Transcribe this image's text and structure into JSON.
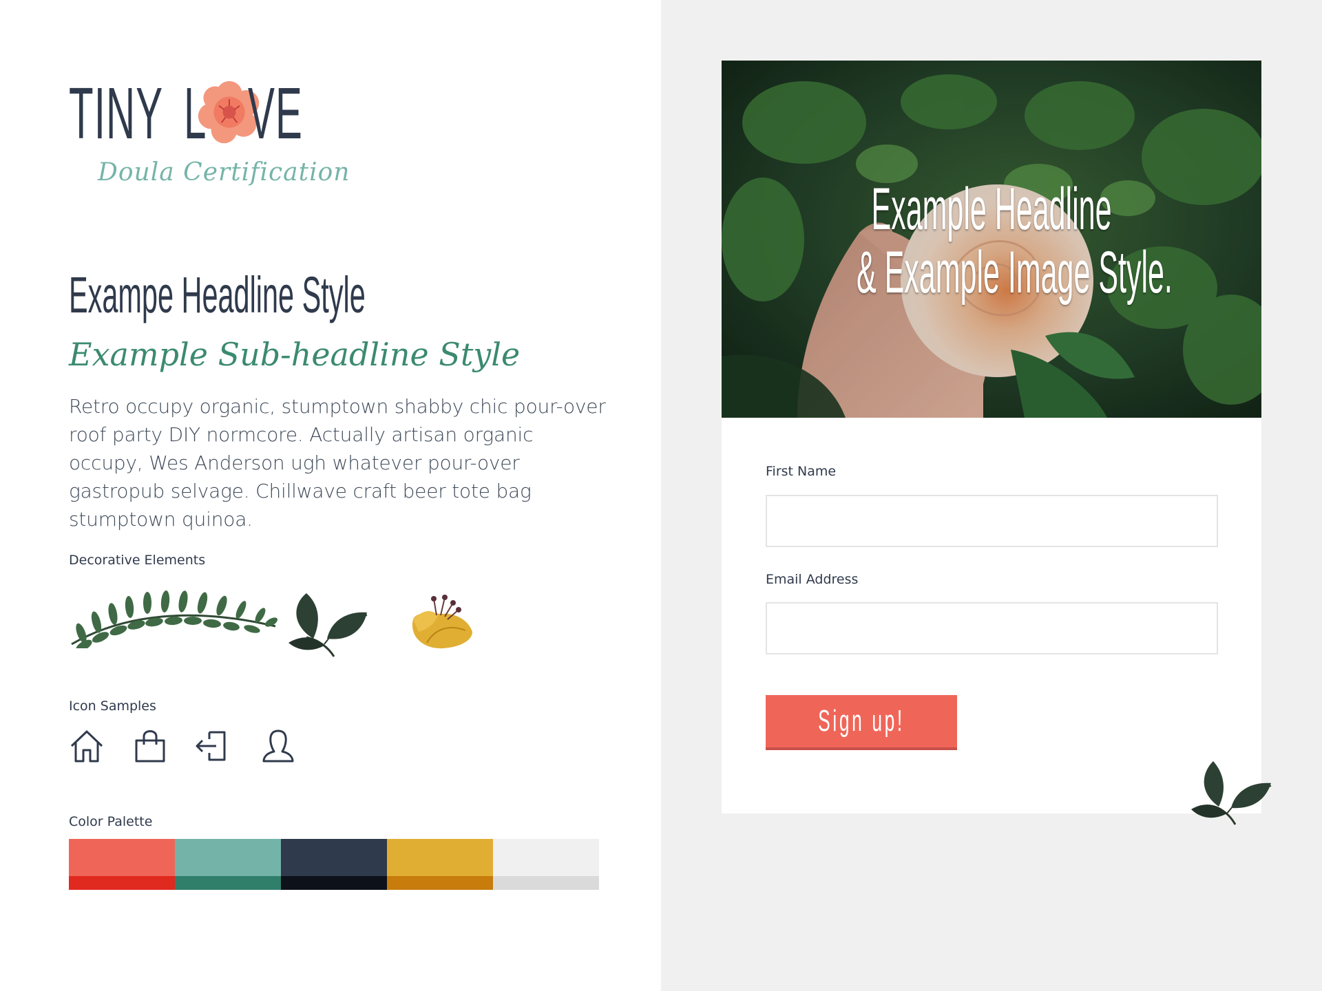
{
  "logo": {
    "word_tiny": "TINY",
    "word_l": "L",
    "word_ve": "VE",
    "subtitle": "Doula Certification"
  },
  "styles": {
    "headline": "Exampe Headline Style",
    "subheadline": "Example Sub-headline Style",
    "body": "Retro occupy organic, stumptown shabby chic pour-over roof party DIY normcore. Actually artisan organic occupy, Wes Anderson ugh whatever pour-over gastropub selvage. Chillwave craft beer tote bag stumptown quinoa."
  },
  "sections": {
    "decorative": "Decorative Elements",
    "icons": "Icon Samples",
    "palette": "Color Palette"
  },
  "decorations": [
    "vine-branch",
    "leaf-sprig",
    "yellow-flower"
  ],
  "icons": [
    "home-icon",
    "shopping-bag-icon",
    "sign-in-icon",
    "user-icon"
  ],
  "palette": [
    {
      "name": "coral",
      "main": "#ef6659",
      "shade": "#e0291f"
    },
    {
      "name": "teal",
      "main": "#74b4a8",
      "shade": "#2f7f6b"
    },
    {
      "name": "navy",
      "main": "#2f3a4c",
      "shade": "#0d111a"
    },
    {
      "name": "mustard",
      "main": "#e0ae33",
      "shade": "#c77c0c"
    },
    {
      "name": "light-gray",
      "main": "#f0f0f0",
      "shade": "#dadada"
    }
  ],
  "hero": {
    "line1": "Example Headline",
    "line2": "& Example Image Style."
  },
  "form": {
    "first_name_label": "First Name",
    "first_name_value": "",
    "email_label": "Email Address",
    "email_value": "",
    "submit_label": "Sign up!"
  }
}
